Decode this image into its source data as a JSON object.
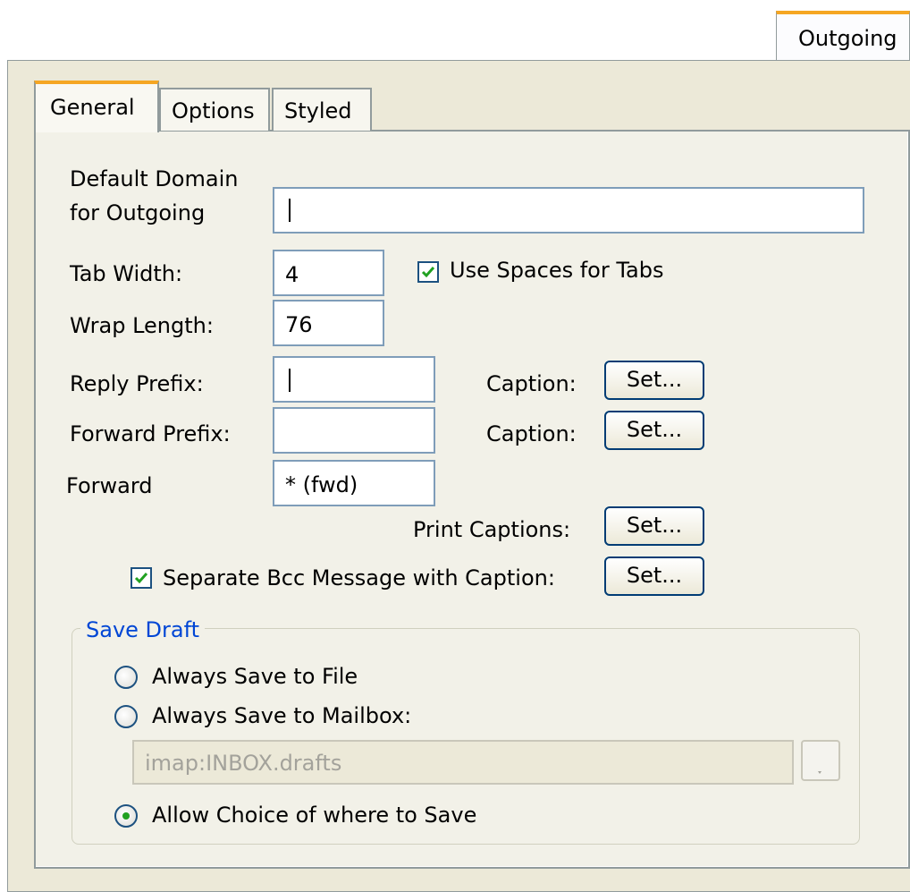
{
  "outer_tab": {
    "label": "Outgoing"
  },
  "tabs": [
    {
      "label": "General",
      "selected": true
    },
    {
      "label": "Options",
      "selected": false
    },
    {
      "label": "Styled",
      "selected": false
    }
  ],
  "general": {
    "default_domain": {
      "label_line1": "Default Domain",
      "label_line2": "for Outgoing",
      "value": ""
    },
    "tab_width": {
      "label": "Tab Width:",
      "value": "4"
    },
    "use_spaces": {
      "label": "Use Spaces for Tabs",
      "checked": true
    },
    "wrap_length": {
      "label": "Wrap Length:",
      "value": "76"
    },
    "reply_prefix": {
      "label": "Reply Prefix:",
      "value": "",
      "caption_label": "Caption:",
      "button": "Set..."
    },
    "forward_prefix": {
      "label": "Forward Prefix:",
      "value": "",
      "caption_label": "Caption:",
      "button": "Set..."
    },
    "forward": {
      "label": "Forward",
      "value": "* (fwd)"
    },
    "print_captions": {
      "label": "Print Captions:",
      "button": "Set..."
    },
    "separate_bcc": {
      "label": "Separate Bcc Message with Caption:",
      "checked": true,
      "button": "Set..."
    }
  },
  "save_draft": {
    "title": "Save Draft",
    "options": [
      {
        "label": "Always Save to File",
        "selected": false
      },
      {
        "label": "Always Save to Mailbox:",
        "selected": false
      },
      {
        "label": "Allow Choice of where to Save",
        "selected": true
      }
    ],
    "mailbox": {
      "value": "imap:INBOX.drafts",
      "enabled": false
    }
  },
  "colors": {
    "accent_tab": "#f5a623",
    "group_title": "#0046d5",
    "check": "#21a121"
  }
}
